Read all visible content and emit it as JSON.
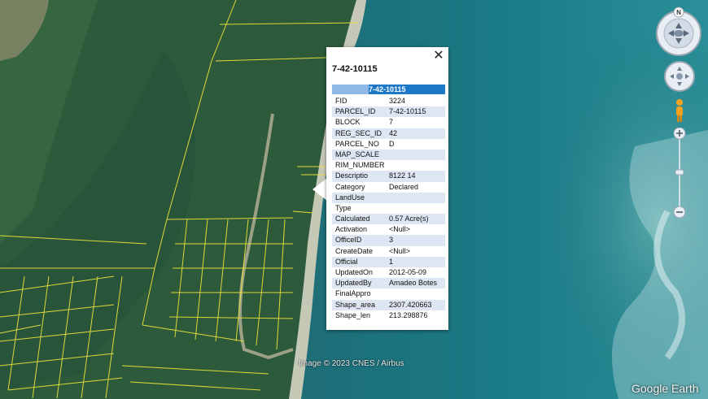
{
  "popup": {
    "title": "7-42-10115",
    "table_header": "7-42-10115",
    "close_icon": "close-icon",
    "rows": [
      {
        "key": "FID",
        "value": "3224"
      },
      {
        "key": "PARCEL_ID",
        "value": "7-42-10115"
      },
      {
        "key": "BLOCK",
        "value": "7"
      },
      {
        "key": "REG_SEC_ID",
        "value": "42"
      },
      {
        "key": "PARCEL_NO",
        "value": "D"
      },
      {
        "key": "MAP_SCALE",
        "value": ""
      },
      {
        "key": "RIM_NUMBER",
        "value": ""
      },
      {
        "key": "Descriptio",
        "value": "8122 14"
      },
      {
        "key": "Category",
        "value": "Declared"
      },
      {
        "key": "LandUse",
        "value": ""
      },
      {
        "key": "Type",
        "value": ""
      },
      {
        "key": "Calculated",
        "value": "0.57 Acre(s)"
      },
      {
        "key": "Activation",
        "value": "<Null>"
      },
      {
        "key": "OfficeID",
        "value": "3"
      },
      {
        "key": "CreateDate",
        "value": "<Null>"
      },
      {
        "key": "Official",
        "value": "1"
      },
      {
        "key": "UpdatedOn",
        "value": "2012-05-09"
      },
      {
        "key": "UpdatedBy",
        "value": "Amadeo Botes"
      },
      {
        "key": "FinalAppro",
        "value": ""
      },
      {
        "key": "Shape_area",
        "value": "2307.420663"
      },
      {
        "key": "Shape_len",
        "value": "213.298876"
      }
    ]
  },
  "map": {
    "attribution": "Image © 2023 CNES / Airbus",
    "brand": "Google Earth",
    "compass_label": "N",
    "colors": {
      "parcel_lines": "#e8e03a",
      "table_header": "#1e78c8",
      "alt_row": "#dde6f2"
    }
  },
  "controls": {
    "icons": [
      "compass-icon",
      "look-joystick-icon",
      "pegman-icon",
      "zoom-in-icon",
      "zoom-out-icon"
    ]
  }
}
